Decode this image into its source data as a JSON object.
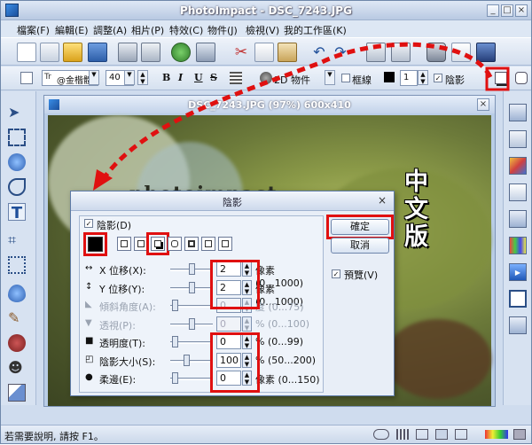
{
  "app": {
    "title": "PhotoImpact - DSC_7243.JPG",
    "menu": [
      "檔案(F)",
      "編輯(E)",
      "調整(A)",
      "相片(P)",
      "特效(C)",
      "物件(J)",
      "檢視(V)",
      "我的工作區(K)"
    ],
    "window_buttons": [
      "_",
      "□",
      "×"
    ]
  },
  "format_bar": {
    "font": "@金楷體",
    "size": "40",
    "bold": "B",
    "italic": "I",
    "underline": "U",
    "strike": "S",
    "mode": "2D 物件",
    "border_label": "框線",
    "border_width": "1",
    "shadow_label": "陰影"
  },
  "document": {
    "title": "DSC_7243.JPG (97%) 600x410",
    "overlay_text": "中文版",
    "watermark_text": "photoimpact"
  },
  "dialog": {
    "title": "陰影",
    "shadow_checkbox": "陰影(D)",
    "shadow_checked": true,
    "color": "#000000",
    "ok": "確定",
    "cancel": "取消",
    "preview": "預覽(V)",
    "preview_checked": true,
    "rows": [
      {
        "name": "x-offset",
        "label": "X 位移(X):",
        "value": "2",
        "range": "像素 (0...1000)",
        "enabled": true,
        "fraction": 0.5
      },
      {
        "name": "y-offset",
        "label": "Y 位移(Y):",
        "value": "2",
        "range": "像素 (0...1000)",
        "enabled": true,
        "fraction": 0.5
      },
      {
        "name": "tilt-angle",
        "label": "傾斜角度(A):",
        "value": "0",
        "range": "度 (0...75)",
        "enabled": false,
        "fraction": 0.05
      },
      {
        "name": "perspective",
        "label": "透視(P):",
        "value": "0",
        "range": "% (0...100)",
        "enabled": false,
        "fraction": 0.5
      },
      {
        "name": "transparency",
        "label": "透明度(T):",
        "value": "0",
        "range": "% (0...99)",
        "enabled": true,
        "fraction": 0.05
      },
      {
        "name": "shadow-size",
        "label": "陰影大小(S):",
        "value": "100",
        "range": "% (50...200)",
        "enabled": true,
        "fraction": 0.35
      },
      {
        "name": "softness",
        "label": "柔邊(E):",
        "value": "0",
        "range": "像素 (0...150)",
        "enabled": true,
        "fraction": 0.05
      }
    ]
  },
  "status": {
    "text": "若需要說明, 請按 F1。"
  },
  "colors": {
    "highlight": "#e01010",
    "accent": "#2d62b0"
  }
}
